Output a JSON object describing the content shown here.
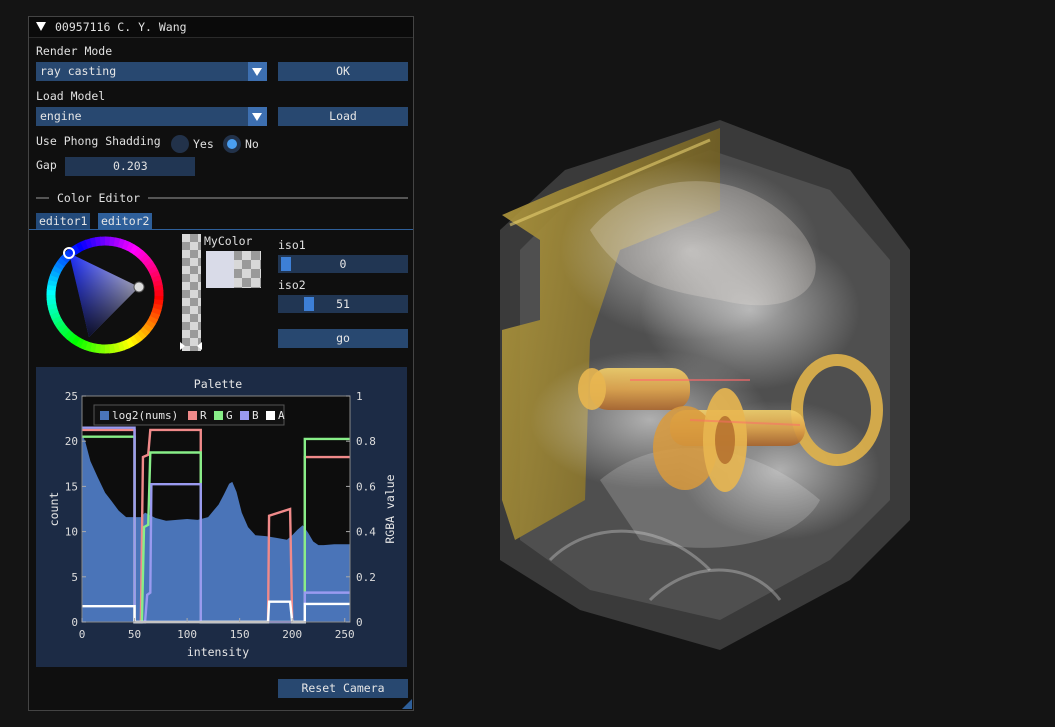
{
  "window": {
    "title": "00957116 C. Y. Wang"
  },
  "render_mode": {
    "label": "Render Mode",
    "value": "ray casting",
    "ok_label": "OK"
  },
  "load_model": {
    "label": "Load Model",
    "value": "engine",
    "load_label": "Load"
  },
  "phong": {
    "label": "Use Phong Shadding",
    "yes_label": "Yes",
    "no_label": "No",
    "selected": "No"
  },
  "gap": {
    "label": "Gap",
    "value": "0.203"
  },
  "color_editor": {
    "title": "Color Editor",
    "tabs": [
      "editor1",
      "editor2"
    ],
    "active_tab": "editor2",
    "swatch_label": "MyColor"
  },
  "iso1": {
    "label": "iso1",
    "value": "0"
  },
  "iso2": {
    "label": "iso2",
    "value": "51"
  },
  "go_label": "go",
  "reset_label": "Reset Camera",
  "colors": {
    "panel_bg": "#0f0f0f",
    "button": "#284870",
    "accent": "#3d7fd6",
    "plot_frame": "#1c2b45",
    "hist": "#4a74b8",
    "R": "#f08a8a",
    "G": "#88ee88",
    "B": "#9a9af0",
    "A": "#ffffff"
  },
  "chart_data": {
    "type": "line",
    "title": "Palette",
    "xlabel": "intensity",
    "ylabel": "count",
    "y2label": "RGBA value",
    "xlim": [
      0,
      255
    ],
    "ylim": [
      0,
      25
    ],
    "y2lim": [
      0,
      1
    ],
    "xticks": [
      "0",
      "50",
      "100",
      "150",
      "200",
      "250"
    ],
    "yticks": [
      "0",
      "5",
      "10",
      "15",
      "20",
      "25"
    ],
    "y2ticks": [
      "0",
      "0.2",
      "0.4",
      "0.6",
      "0.8",
      "1"
    ],
    "legend": [
      "log2(nums)",
      "R",
      "G",
      "B",
      "A"
    ],
    "histogram": {
      "name": "log2(nums)",
      "x": [
        0,
        3,
        8,
        15,
        22,
        28,
        35,
        42,
        50,
        56,
        60,
        70,
        80,
        90,
        100,
        110,
        120,
        125,
        130,
        135,
        140,
        143,
        147,
        152,
        158,
        165,
        175,
        185,
        195,
        200,
        205,
        210,
        215,
        220,
        225,
        230,
        240,
        250,
        255
      ],
      "y": [
        20.8,
        20.0,
        17.8,
        16.0,
        14.3,
        13.4,
        12.3,
        11.6,
        11.6,
        11.6,
        12.1,
        11.5,
        11.2,
        11.3,
        11.4,
        11.3,
        11.6,
        12.3,
        13.0,
        14.1,
        15.3,
        15.5,
        14.4,
        12.1,
        10.5,
        9.6,
        9.5,
        9.3,
        9.1,
        9.6,
        10.2,
        10.7,
        9.9,
        8.9,
        8.5,
        8.5,
        8.6,
        8.6,
        8.6
      ]
    },
    "series": [
      {
        "name": "R",
        "x": [
          0,
          50,
          50,
          56,
          58,
          63,
          65,
          113,
          113,
          177,
          178,
          198,
          200,
          212,
          212,
          255
        ],
        "y": [
          0.85,
          0.85,
          0,
          0,
          0.73,
          0.74,
          0.85,
          0.85,
          0,
          0,
          0.47,
          0.5,
          0,
          0,
          0.73,
          0.73
        ]
      },
      {
        "name": "G",
        "x": [
          0,
          50,
          50,
          57,
          59,
          63,
          65,
          113,
          113,
          212,
          212,
          255
        ],
        "y": [
          0.82,
          0.82,
          0,
          0,
          0.42,
          0.43,
          0.75,
          0.75,
          0,
          0,
          0.81,
          0.81
        ]
      },
      {
        "name": "B",
        "x": [
          0,
          50,
          50,
          60,
          62,
          65,
          66,
          113,
          113,
          212,
          212,
          255
        ],
        "y": [
          0.86,
          0.86,
          0,
          0,
          0.12,
          0.13,
          0.61,
          0.61,
          0,
          0,
          0.13,
          0.13
        ]
      },
      {
        "name": "A",
        "x": [
          0,
          50,
          50,
          177,
          178,
          198,
          200,
          212,
          212,
          255
        ],
        "y": [
          0.07,
          0.07,
          0,
          0,
          0.09,
          0.09,
          0,
          0,
          0.08,
          0.08
        ]
      }
    ]
  },
  "viewport": {
    "description_icon": "volume-render-engine"
  }
}
